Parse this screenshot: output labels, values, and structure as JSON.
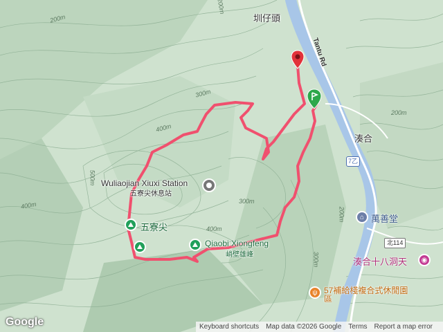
{
  "map": {
    "places": {
      "zhuzaitou": "圳仔頭",
      "couhe": "湊合",
      "wanshantang": "萬善堂",
      "cave": "湊合十八洞天",
      "restaurant": "57補給棧複合式休閒園區"
    },
    "station": {
      "en": "Wuliaojian Xiuxi Station",
      "zh": "五寮尖休息站"
    },
    "peaks": {
      "wuliaojian": "五寮尖",
      "qiaobi_en": "Qiaobi Xiongfeng",
      "qiaobi_zh": "峭壁雄峰"
    },
    "road": {
      "name": "Tantu Rd",
      "shield_7": "7乙",
      "shield_114": "北114"
    },
    "contours": {
      "c200a": "200m",
      "c200b": "200m",
      "c200c": "200m",
      "c200d": "200m",
      "c300a": "300m",
      "c300b": "300m",
      "c300c": "300m",
      "c400a": "400m",
      "c400b": "400m",
      "c400c": "400m",
      "c500": "500m"
    },
    "attribution": {
      "logo": "Google",
      "shortcuts": "Keyboard shortcuts",
      "data": "Map data ©2026 Google",
      "terms": "Terms",
      "report": "Report a map error"
    },
    "colors": {
      "route": "#f0506e",
      "river": "#a8c6e8",
      "start_pin": "#2ea84b",
      "end_pin": "#e2323a",
      "park": "#21a05a",
      "poi_blue": "#6d7fa8",
      "poi_pink": "#c33a93"
    }
  }
}
